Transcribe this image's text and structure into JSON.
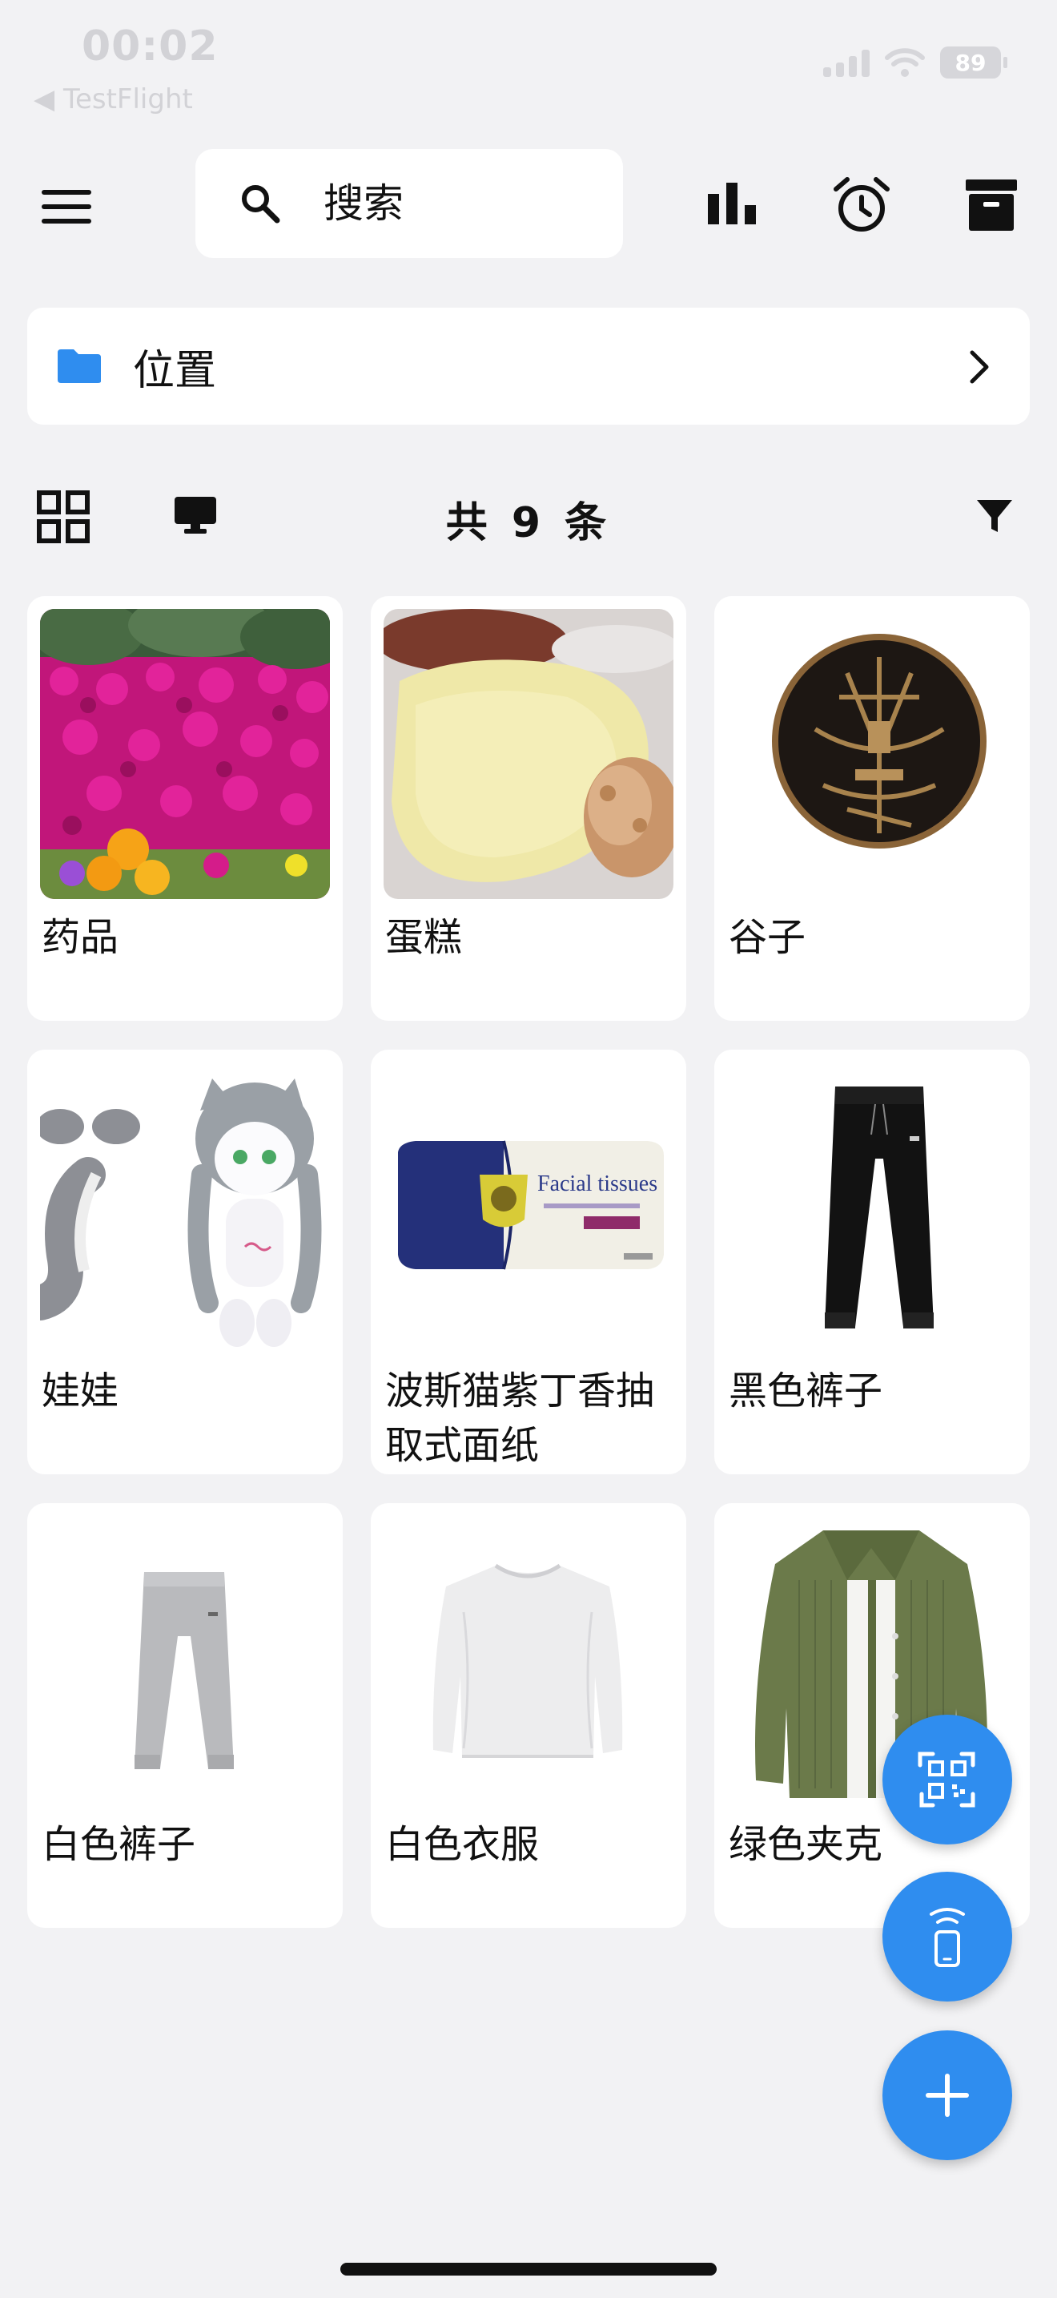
{
  "status_bar": {
    "time": "00:02",
    "back_app": "◀ TestFlight",
    "battery": "89"
  },
  "toolbar": {
    "search_placeholder": "搜索",
    "icons": [
      "menu-icon",
      "search-icon",
      "bar-chart-icon",
      "alarm-clock-icon",
      "archive-box-icon"
    ]
  },
  "location": {
    "label": "位置",
    "icon": "folder-icon"
  },
  "view": {
    "count_text": "共 9 条",
    "icons": [
      "grid-view-icon",
      "monitor-icon",
      "filter-icon"
    ]
  },
  "items": [
    {
      "title": "药品",
      "image": "pink-flowers"
    },
    {
      "title": "蛋糕",
      "image": "cake-plate"
    },
    {
      "title": "谷子",
      "image": "bronze-badge"
    },
    {
      "title": "娃娃",
      "image": "plush-doll"
    },
    {
      "title": "波斯猫紫丁香抽取式面纸",
      "image": "facial-tissues-pack"
    },
    {
      "title": "黑色裤子",
      "image": "black-pants"
    },
    {
      "title": "白色裤子",
      "image": "white-pants"
    },
    {
      "title": "白色衣服",
      "image": "white-shirt"
    },
    {
      "title": "绿色夹克",
      "image": "green-jacket"
    }
  ],
  "images_text": {
    "tissue_brand": "Facial tissues"
  },
  "fabs": [
    "qr-scan-icon",
    "nfc-phone-icon",
    "plus-icon"
  ],
  "colors": {
    "accent": "#2f8def",
    "background": "#f2f2f4",
    "folder": "#2f8def"
  }
}
